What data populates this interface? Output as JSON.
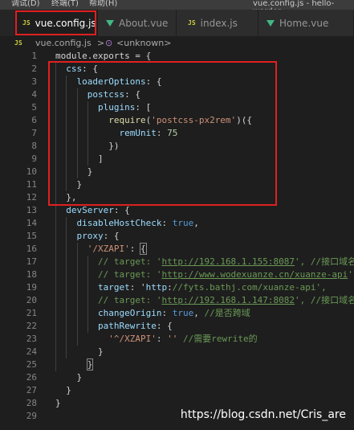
{
  "menubar": {
    "items": [
      "调试(D)",
      "终端(T)",
      "帮助(H)"
    ],
    "title": "vue.config.js - hello-worder"
  },
  "tabs": [
    {
      "label": "vue.config.js",
      "icon": "js-icon",
      "active": true
    },
    {
      "label": "About.vue",
      "icon": "vue-icon",
      "active": false
    },
    {
      "label": "index.js",
      "icon": "js-icon",
      "active": false
    },
    {
      "label": "Home.vue",
      "icon": "vue-icon",
      "active": false
    }
  ],
  "close_glyph": "×",
  "breadcrumb": {
    "file": "vue.config.js",
    "separator": ">",
    "symbol": "<unknown>"
  },
  "code_lines": [
    "module.exports = {",
    "  css: {",
    "    loaderOptions: {",
    "      postcss: {",
    "        plugins: [",
    "          require('postcss-px2rem')({",
    "            remUnit: 75",
    "          })",
    "        ]",
    "      }",
    "    }",
    "  },",
    "  devServer: {",
    "    disableHostCheck: true,",
    "    proxy: {",
    "      '/XZAPI': {",
    "        // target: 'http://192.168.1.155:8087', //接口域名",
    "        // target: 'http://www.wodexuanze.cn/xuanze-api',",
    "        target: 'http://fyts.bathj.com/xuanze-api',",
    "        // target: 'http://192.168.1.147:8082', //接口域名",
    "        changeOrigin: true, //是否跨域",
    "        pathRewrite: {",
    "          '^/XZAPI': '' //需要rewrite的",
    "        }",
    "      }",
    "    }",
    "  }",
    "}",
    ""
  ],
  "watermark": "https://blog.csdn.net/Cris_are",
  "colors": {
    "highlight_box": "#e02020",
    "js_icon": "#cbcb41",
    "vue_icon": "#41b883"
  }
}
